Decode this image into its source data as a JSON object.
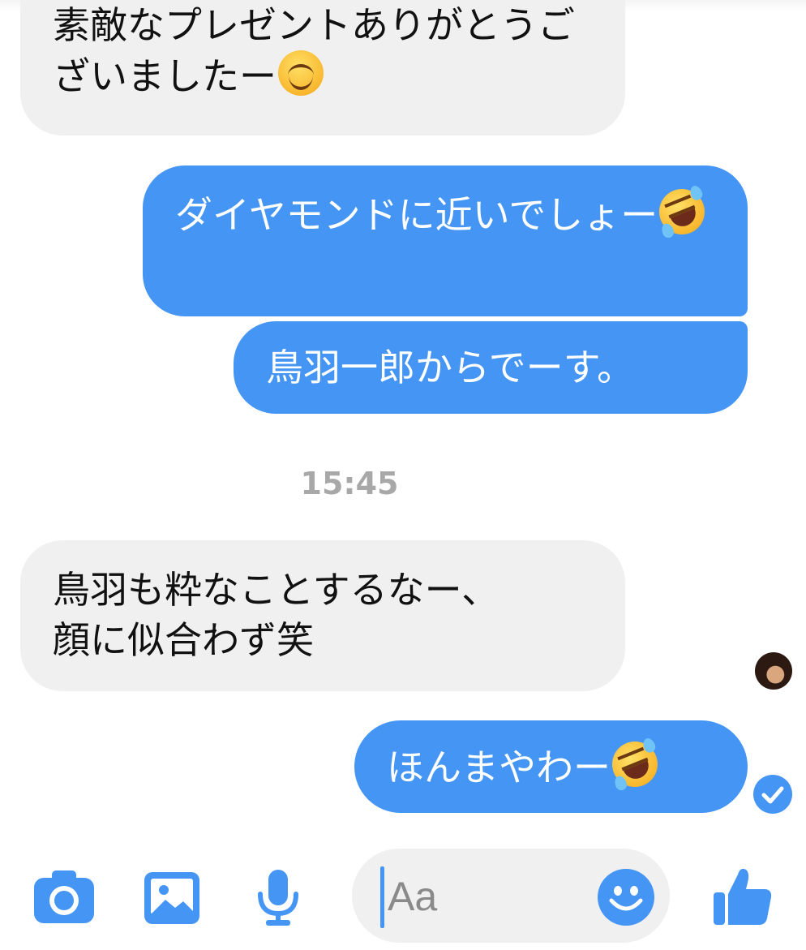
{
  "conversation": {
    "messages": [
      {
        "side": "incoming",
        "text": "素敵なプレゼントありがとうございましたー",
        "emoji": "smiling-face-icon"
      },
      {
        "side": "outgoing",
        "text": "ダイヤモンドに近いでしょー",
        "emoji": "rolling-on-floor-laughing-icon"
      },
      {
        "side": "outgoing",
        "text": "鳥羽一郎からでーす。"
      },
      {
        "side": "incoming",
        "text": "鳥羽も粋なことするなー、\n顔に似合わず笑"
      },
      {
        "side": "outgoing",
        "text": "ほんまやわー",
        "emoji": "rolling-on-floor-laughing-icon"
      }
    ],
    "timestamp": "15:45",
    "status": "sent"
  },
  "composer": {
    "placeholder": "Aa",
    "icons": [
      "camera-icon",
      "photo-icon",
      "microphone-icon",
      "emoji-icon",
      "thumbs-up-icon"
    ]
  },
  "colors": {
    "outgoing_bubble": "#4595f5",
    "incoming_bubble": "#f1f0f0",
    "accent": "#4595f5",
    "timestamp": "#a8a8a8"
  }
}
